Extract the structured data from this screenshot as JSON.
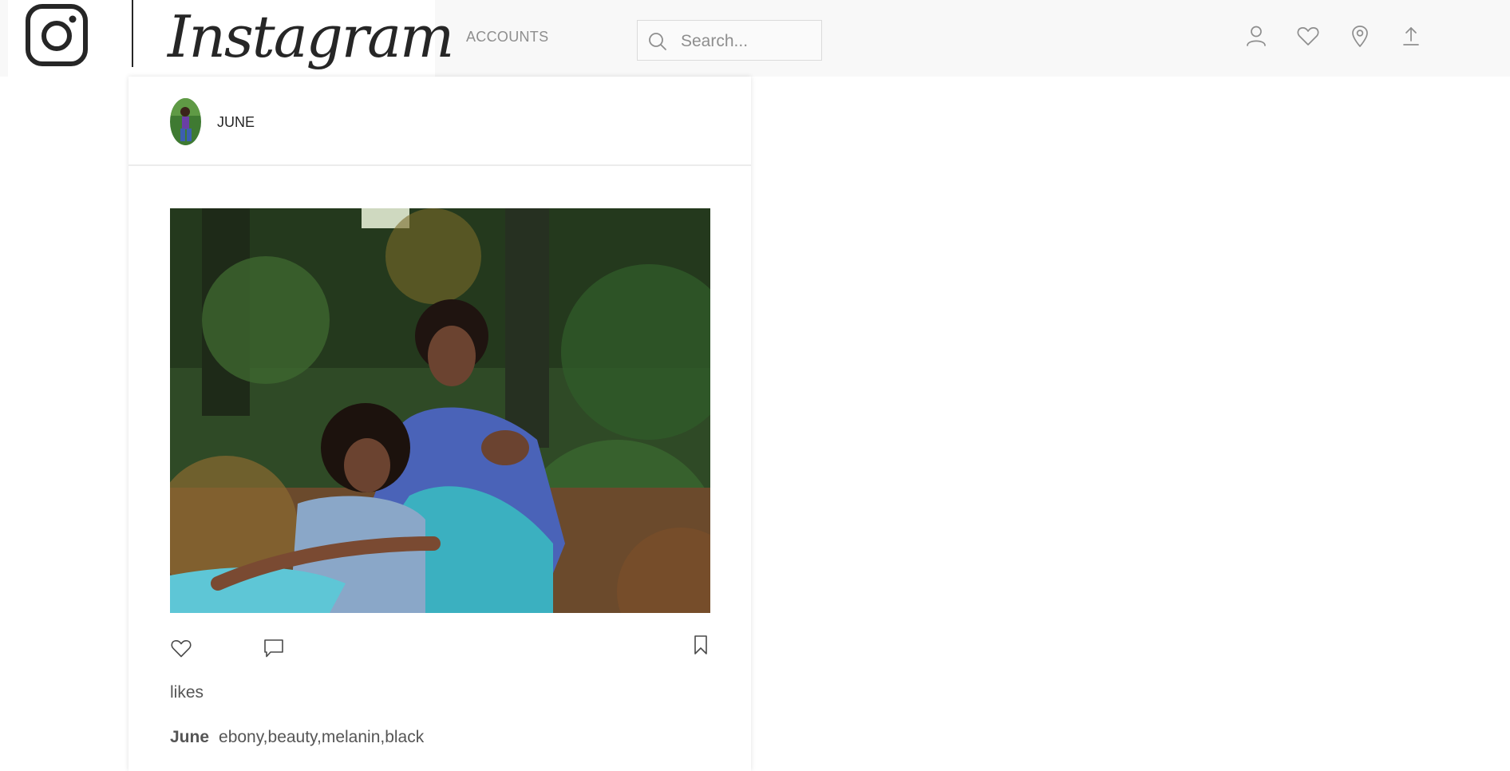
{
  "header": {
    "brand_wordmark": "Instagram",
    "accounts_label": "ACCOUNTS",
    "search": {
      "placeholder": "Search...",
      "value": ""
    },
    "nav_icons": [
      "user-icon",
      "heart-icon",
      "map-pin-icon",
      "upload-icon"
    ]
  },
  "post": {
    "username": "JUNE",
    "actions": [
      "heart-icon",
      "comment-icon",
      "bookmark-icon"
    ],
    "likes_label": "likes",
    "caption_user": "June",
    "caption_text": "ebony,beauty,melanin,black"
  },
  "colors": {
    "header_bg": "#f8f8f8",
    "icon_gray": "#8e8e8e",
    "text_dark": "#262626",
    "text_muted": "#555555"
  }
}
